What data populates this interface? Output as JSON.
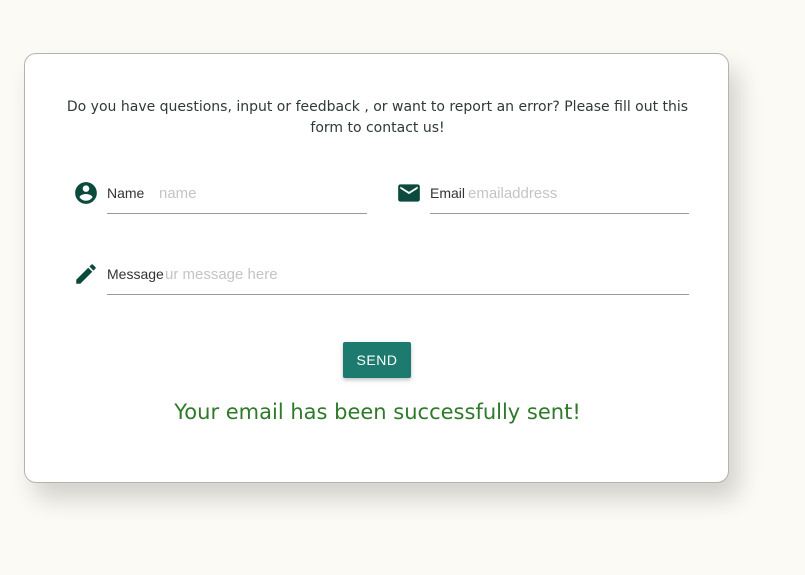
{
  "intro_text": "Do you have questions, input or feedback , or want to report an error? Please fill out this form to contact us!",
  "name_field": {
    "label": "Name",
    "placeholder": "name",
    "icon": "account-circle-icon"
  },
  "email_field": {
    "label": "Email",
    "placeholder": "emailaddress",
    "icon": "mail-icon"
  },
  "message_field": {
    "label": "Message",
    "placeholder": "ur message here",
    "icon": "pencil-icon"
  },
  "send_button": {
    "label": "SEND"
  },
  "status_message": "Your email has been successfully sent!",
  "colors": {
    "accent": "#1c7a6f",
    "icon": "#0d4a3e",
    "success": "#2f7a2a",
    "background": "#fcfaf4"
  }
}
